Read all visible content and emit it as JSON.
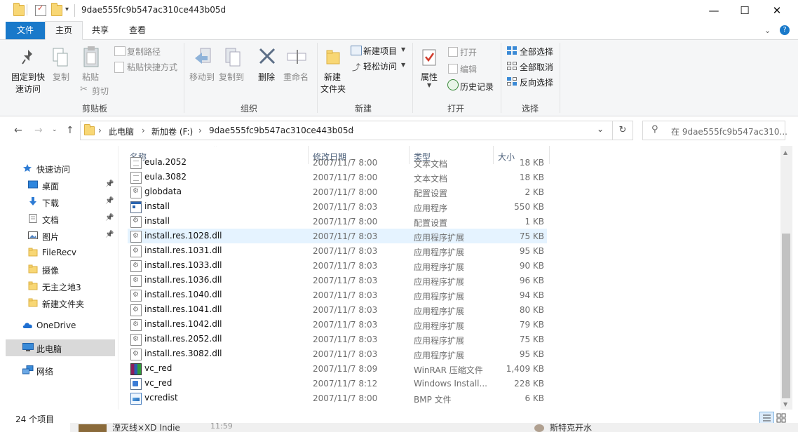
{
  "window": {
    "title": "9dae555fc9b547ac310ce443b05d",
    "minimize": "—",
    "maximize": "☐",
    "close": "✕",
    "qa_dropdown": "▾"
  },
  "ribbon_tabs": [
    "文件",
    "主页",
    "共享",
    "查看"
  ],
  "ribbon": {
    "clipboard": {
      "pin": "固定到快",
      "pin2": "速访问",
      "copy": "复制",
      "paste": "粘贴",
      "copy_path": "复制路径",
      "paste_shortcut": "粘贴快捷方式",
      "cut": "剪切",
      "label": "剪贴板"
    },
    "organize": {
      "move_to": "移动到",
      "copy_to": "复制到",
      "delete": "删除",
      "rename": "重命名",
      "label": "组织"
    },
    "new": {
      "new_folder": "新建",
      "new_folder2": "文件夹",
      "new_item": "新建项目",
      "easy_access": "轻松访问",
      "label": "新建"
    },
    "open": {
      "properties": "属性",
      "open": "打开",
      "edit": "编辑",
      "history": "历史记录",
      "label": "打开"
    },
    "select": {
      "select_all": "全部选择",
      "select_none": "全部取消",
      "invert": "反向选择",
      "label": "选择"
    }
  },
  "address": {
    "crumbs": [
      "此电脑",
      "新加卷 (F:)",
      "9dae555fc9b547ac310ce443b05d"
    ],
    "search_placeholder": "在 9dae555fc9b547ac310..."
  },
  "nav": [
    {
      "label": "快速访问",
      "icon": "star-icon",
      "pinned": false
    },
    {
      "label": "桌面",
      "icon": "desktop-icon",
      "pinned": true
    },
    {
      "label": "下载",
      "icon": "download-icon",
      "pinned": true
    },
    {
      "label": "文档",
      "icon": "document-icon",
      "pinned": true
    },
    {
      "label": "图片",
      "icon": "picture-icon",
      "pinned": true
    },
    {
      "label": "FileRecv",
      "icon": "folder-icon",
      "pinned": false
    },
    {
      "label": "摄像",
      "icon": "folder-icon",
      "pinned": false
    },
    {
      "label": "无主之地3",
      "icon": "folder-icon",
      "pinned": false
    },
    {
      "label": "新建文件夹",
      "icon": "folder-icon",
      "pinned": false
    },
    {
      "label": "OneDrive",
      "icon": "cloud-icon",
      "pinned": false
    },
    {
      "label": "此电脑",
      "icon": "computer-icon",
      "pinned": false
    },
    {
      "label": "网络",
      "icon": "network-icon",
      "pinned": false
    }
  ],
  "columns": {
    "name": "名称",
    "date": "修改日期",
    "type": "类型",
    "size": "大小"
  },
  "files": [
    {
      "name": "eula.2052",
      "date": "2007/11/7 8:00",
      "type": "文本文档",
      "size": "18 KB",
      "icon": "doc"
    },
    {
      "name": "eula.3082",
      "date": "2007/11/7 8:00",
      "type": "文本文档",
      "size": "18 KB",
      "icon": "doc"
    },
    {
      "name": "globdata",
      "date": "2007/11/7 8:00",
      "type": "配置设置",
      "size": "2 KB",
      "icon": "cfg"
    },
    {
      "name": "install",
      "date": "2007/11/7 8:03",
      "type": "应用程序",
      "size": "550 KB",
      "icon": "exe"
    },
    {
      "name": "install",
      "date": "2007/11/7 8:00",
      "type": "配置设置",
      "size": "1 KB",
      "icon": "cfg"
    },
    {
      "name": "install.res.1028.dll",
      "date": "2007/11/7 8:03",
      "type": "应用程序扩展",
      "size": "75 KB",
      "icon": "dll"
    },
    {
      "name": "install.res.1031.dll",
      "date": "2007/11/7 8:03",
      "type": "应用程序扩展",
      "size": "95 KB",
      "icon": "dll"
    },
    {
      "name": "install.res.1033.dll",
      "date": "2007/11/7 8:03",
      "type": "应用程序扩展",
      "size": "90 KB",
      "icon": "dll"
    },
    {
      "name": "install.res.1036.dll",
      "date": "2007/11/7 8:03",
      "type": "应用程序扩展",
      "size": "96 KB",
      "icon": "dll"
    },
    {
      "name": "install.res.1040.dll",
      "date": "2007/11/7 8:03",
      "type": "应用程序扩展",
      "size": "94 KB",
      "icon": "dll"
    },
    {
      "name": "install.res.1041.dll",
      "date": "2007/11/7 8:03",
      "type": "应用程序扩展",
      "size": "80 KB",
      "icon": "dll"
    },
    {
      "name": "install.res.1042.dll",
      "date": "2007/11/7 8:03",
      "type": "应用程序扩展",
      "size": "79 KB",
      "icon": "dll"
    },
    {
      "name": "install.res.2052.dll",
      "date": "2007/11/7 8:03",
      "type": "应用程序扩展",
      "size": "75 KB",
      "icon": "dll"
    },
    {
      "name": "install.res.3082.dll",
      "date": "2007/11/7 8:03",
      "type": "应用程序扩展",
      "size": "95 KB",
      "icon": "dll"
    },
    {
      "name": "vc_red",
      "date": "2007/11/7 8:09",
      "type": "WinRAR 压缩文件",
      "size": "1,409 KB",
      "icon": "rar"
    },
    {
      "name": "vc_red",
      "date": "2007/11/7 8:12",
      "type": "Windows Install...",
      "size": "228 KB",
      "icon": "msi"
    },
    {
      "name": "vcredist",
      "date": "2007/11/7 8:00",
      "type": "BMP 文件",
      "size": "6 KB",
      "icon": "bmp"
    }
  ],
  "selected_index": 5,
  "status": {
    "count": "24 个项目"
  },
  "taskbar_fragment": {
    "text": "湮灭线×XD Indie",
    "time": "11:59",
    "right": "斯特克开水"
  }
}
